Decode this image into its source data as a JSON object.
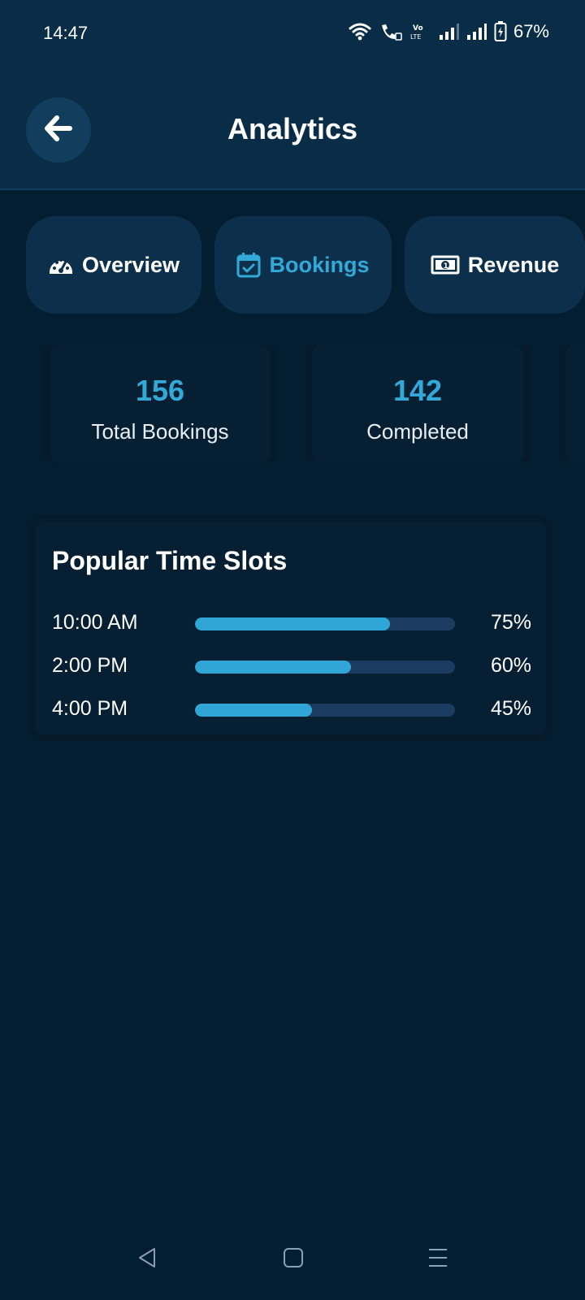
{
  "status_bar": {
    "time": "14:47",
    "battery": "67%",
    "icons": [
      "wifi-icon",
      "wifi-calling-icon",
      "volte-icon",
      "signal-icon",
      "signal-icon",
      "battery-icon"
    ]
  },
  "header": {
    "title": "Analytics",
    "back_icon": "arrow-left-icon"
  },
  "tabs": [
    {
      "label": "Overview",
      "icon": "speedometer-icon",
      "active": false
    },
    {
      "label": "Bookings",
      "icon": "calendar-check-icon",
      "active": true
    },
    {
      "label": "Revenue",
      "icon": "banknote-icon",
      "active": false
    }
  ],
  "stats": [
    {
      "value": "156",
      "label": "Total Bookings"
    },
    {
      "value": "142",
      "label": "Completed"
    }
  ],
  "popular_slots": {
    "title": "Popular Time Slots",
    "items": [
      {
        "time": "10:00 AM",
        "percent": 75,
        "percent_label": "75%"
      },
      {
        "time": "2:00 PM",
        "percent": 60,
        "percent_label": "60%"
      },
      {
        "time": "4:00 PM",
        "percent": 45,
        "percent_label": "45%"
      }
    ]
  },
  "colors": {
    "background": "#041e31",
    "header": "#0a2d47",
    "accent": "#33a9d8",
    "track": "#1c3b60"
  },
  "nav_bar": [
    "back-triangle-icon",
    "home-square-icon",
    "recents-menu-icon"
  ]
}
